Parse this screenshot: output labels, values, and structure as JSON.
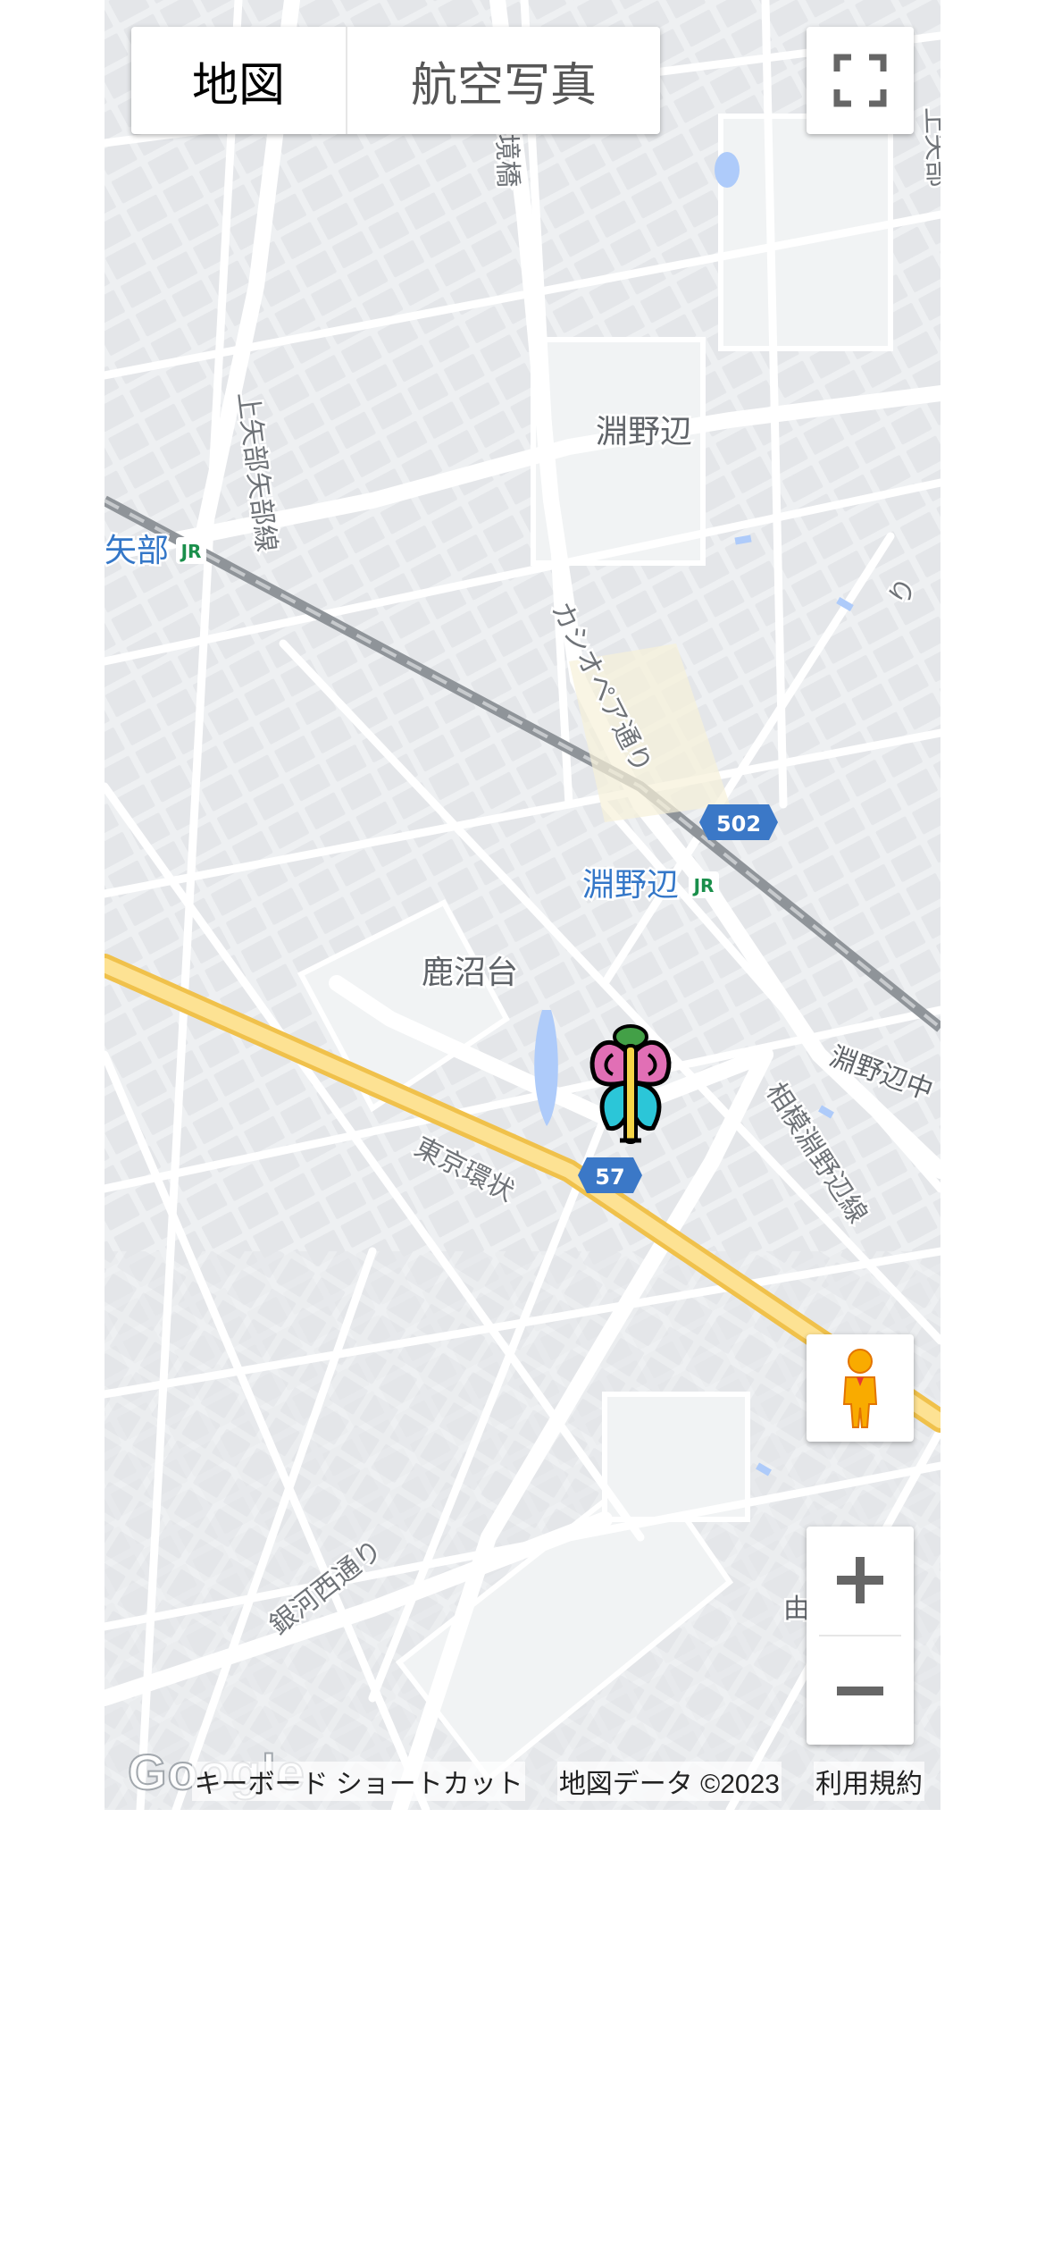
{
  "map_type": {
    "map_label": "地図",
    "satellite_label": "航空写真"
  },
  "controls": {
    "fullscreen": "fullscreen-icon",
    "street_view": "pegman-icon",
    "zoom_in": "plus-icon",
    "zoom_out": "minus-icon"
  },
  "labels": {
    "area_fuchinobe": "淵野辺",
    "area_kanumadai": "鹿沼台",
    "area_fuchinobe_naka": "淵野辺中",
    "street_kamiyabe": "上矢部矢部線",
    "street_sakaibashi": "境橋",
    "street_cassiopeia": "カシオペア通り",
    "street_tokyo_kanjo": "東京環状",
    "street_ginga_nishi": "銀河西通り",
    "street_sagami_fuchinobe": "相模淵野辺線",
    "street_ai_partial": "り",
    "street_right_top": "上矢部",
    "station_yabe": "矢部",
    "station_fuchinobe": "淵野辺",
    "partial_right": "由",
    "jr_mark": "JR",
    "route_502": "502",
    "route_57": "57"
  },
  "attribution": {
    "logo": "Google",
    "shortcuts": "キーボード ショートカット",
    "map_data": "地図データ ©2023",
    "terms": "利用規約"
  },
  "marker": {
    "icon": "butterfly-icon"
  },
  "colors": {
    "map_bg": "#f1f3f4",
    "road": "#ffffff",
    "highway": "#fbd36b",
    "railway": "#9aa0a6",
    "water": "#aecbfa",
    "route_shield": "#3b78c7",
    "station_text": "#3477c8",
    "jr_green": "#1a8f4b"
  }
}
